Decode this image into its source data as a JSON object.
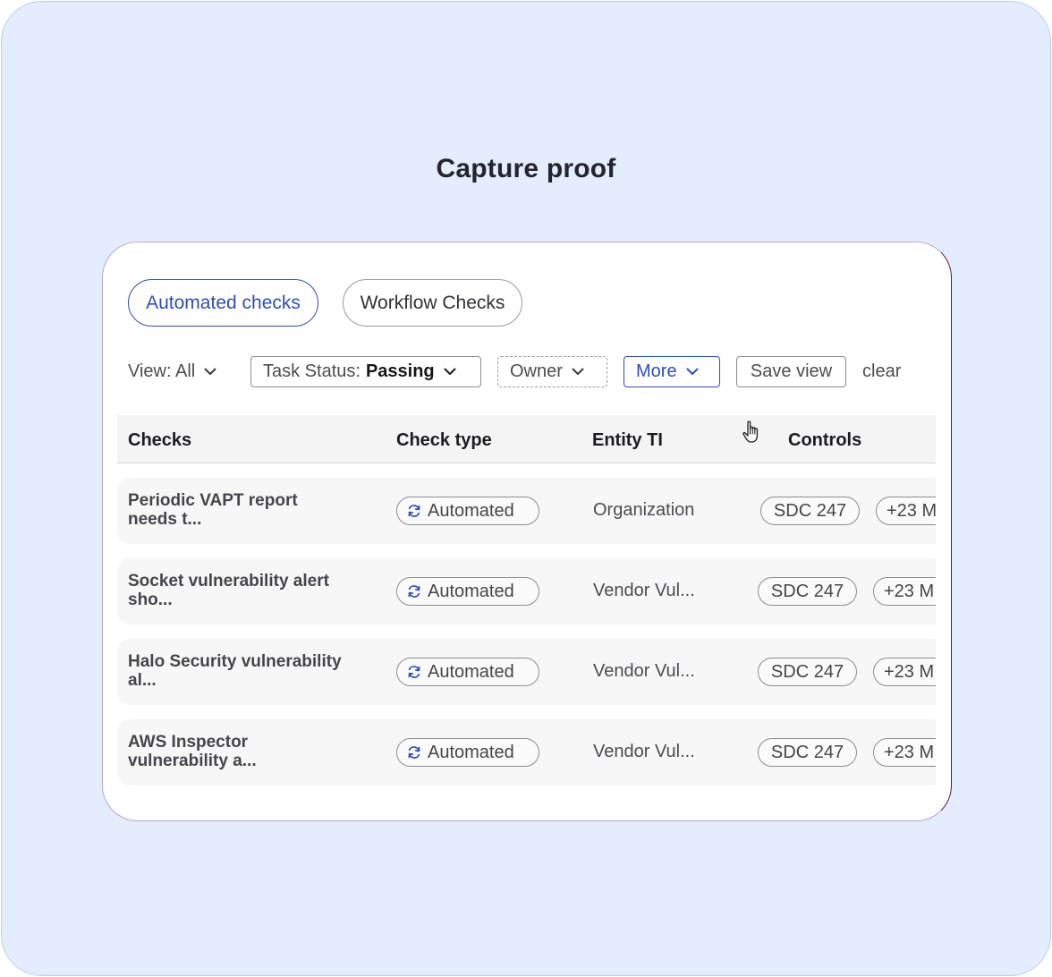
{
  "title": "Capture proof",
  "tabs": [
    {
      "label": "Automated checks",
      "active": true
    },
    {
      "label": "Workflow Checks",
      "active": false
    }
  ],
  "filters": {
    "view": "View: All",
    "task_status_label": "Task Status:",
    "task_status_value": "Passing",
    "owner": "Owner",
    "more": "More",
    "save_view": "Save view",
    "clear": "clear"
  },
  "table": {
    "columns": [
      "Checks",
      "Check type",
      "Entity TI",
      "Controls"
    ],
    "rows": [
      {
        "check": "Periodic VAPT report needs t...",
        "type": "Automated",
        "entity": "Organization",
        "control": "SDC 247",
        "more": "+23 M"
      },
      {
        "check": "Socket vulnerability alert sho...",
        "type": "Automated",
        "entity": "Vendor Vul...",
        "control": "SDC 247",
        "more": "+23 M"
      },
      {
        "check": "Halo Security vulnerability al...",
        "type": "Automated",
        "entity": "Vendor Vul...",
        "control": "SDC 247",
        "more": "+23 M"
      },
      {
        "check": "AWS Inspector vulnerability a...",
        "type": "Automated",
        "entity": "Vendor Vul...",
        "control": "SDC 247",
        "more": "+23 M"
      }
    ]
  },
  "icons": {
    "check_type": "refresh-icon",
    "dropdown": "chevron-down-icon",
    "cursor": "hand-pointer-icon"
  },
  "colors": {
    "background": "#e3edfe",
    "accent": "#2c4fb3",
    "card": "#ffffff",
    "row": "#f7f7f8"
  }
}
